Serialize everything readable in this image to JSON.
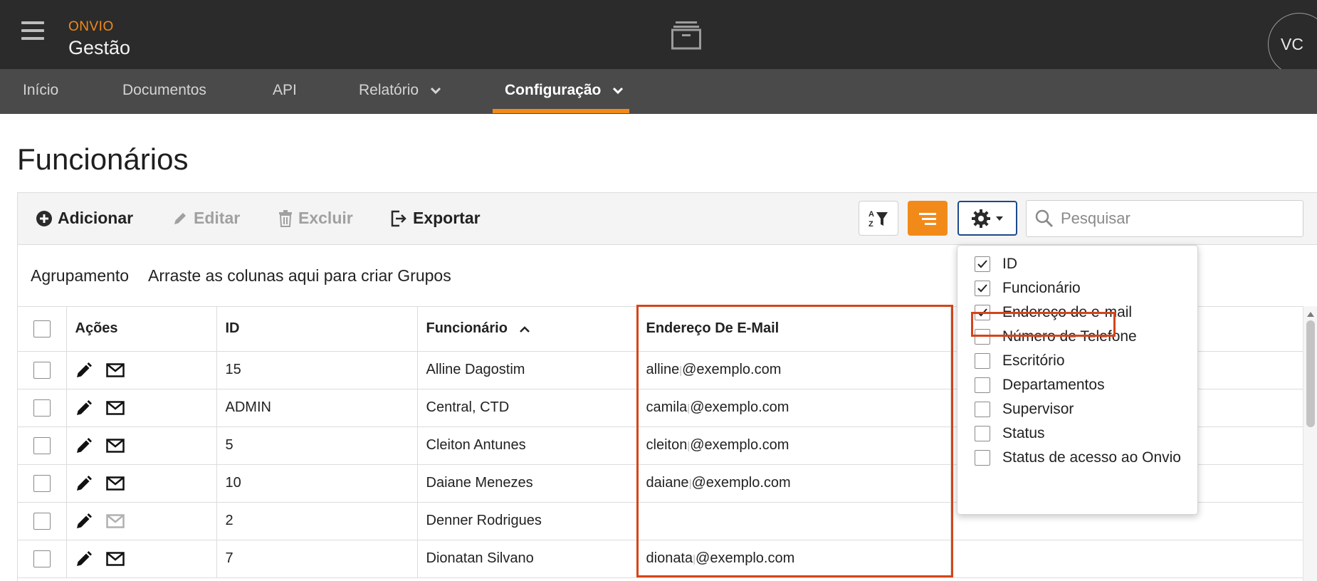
{
  "header": {
    "brand_top": "ONVIO",
    "brand_bottom": "Gestão",
    "user_initials": "VC",
    "icons": {
      "menu": "hamburger-icon",
      "center": "archive-box-icon"
    }
  },
  "nav": {
    "items": [
      {
        "label": "Início",
        "dropdown": false,
        "active": false
      },
      {
        "label": "Documentos",
        "dropdown": false,
        "active": false
      },
      {
        "label": "API",
        "dropdown": false,
        "active": false
      },
      {
        "label": "Relatório",
        "dropdown": true,
        "active": false
      },
      {
        "label": "Configuração",
        "dropdown": true,
        "active": true
      }
    ],
    "accent_color": "#f28a1a"
  },
  "page": {
    "title": "Funcionários"
  },
  "toolbar": {
    "add_label": "Adicionar",
    "edit_label": "Editar",
    "delete_label": "Excluir",
    "export_label": "Exportar",
    "search_placeholder": "Pesquisar"
  },
  "grouping": {
    "label": "Agrupamento",
    "hint": "Arraste as colunas aqui para criar Grupos"
  },
  "table": {
    "columns": [
      "Ações",
      "ID",
      "Funcionário",
      "Endereço De E-Mail"
    ],
    "sorted_column": "Funcionário",
    "sort_direction": "ascending",
    "rows": [
      {
        "id": "15",
        "name": "Alline Dagostim",
        "email_user": "alline",
        "email_domain": "@exemplo.com",
        "email_enabled": true
      },
      {
        "id": "ADMIN",
        "name": "Central, CTD",
        "email_user": "camila",
        "email_domain": "@exemplo.com",
        "email_enabled": true
      },
      {
        "id": "5",
        "name": "Cleiton Antunes",
        "email_user": "cleiton",
        "email_domain": "@exemplo.com",
        "email_enabled": true
      },
      {
        "id": "10",
        "name": "Daiane Menezes",
        "email_user": "daiane",
        "email_domain": "@exemplo.com",
        "email_enabled": true
      },
      {
        "id": "2",
        "name": "Denner Rodrigues",
        "email_user": "",
        "email_domain": "",
        "email_enabled": false
      },
      {
        "id": "7",
        "name": "Dionatan Silvano",
        "email_user": "dionata",
        "email_domain": "@exemplo.com",
        "email_enabled": true
      }
    ]
  },
  "column_chooser": {
    "options": [
      {
        "label": "ID",
        "checked": true
      },
      {
        "label": "Funcionário",
        "checked": true
      },
      {
        "label": "Endereço de e-mail",
        "checked": true
      },
      {
        "label": "Número de Telefone",
        "checked": false
      },
      {
        "label": "Escritório",
        "checked": false
      },
      {
        "label": "Departamentos",
        "checked": false
      },
      {
        "label": "Supervisor",
        "checked": false
      },
      {
        "label": "Status",
        "checked": false
      },
      {
        "label": "Status de acesso ao Onvio",
        "checked": false
      }
    ],
    "highlight_color": "#d4451a"
  }
}
